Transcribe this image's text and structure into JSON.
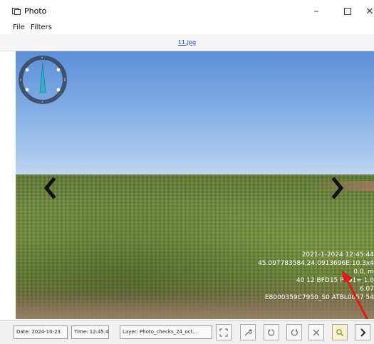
{
  "window": {
    "title": "Photo",
    "minimize": "–",
    "close": "✕"
  },
  "menu": {
    "file": "File",
    "filters": "Filters"
  },
  "top_link": "11.jpg",
  "photo": {
    "overlay_lines": [
      "2021-1-2024 12:45:44",
      "45.097783584,24.0913696E:10.3x4",
      "0.0, m",
      "40 12 BFD15 PR91= 1.0",
      "6.07",
      "E8000359C7950_S0 ATBL0057 54"
    ]
  },
  "status": {
    "date": "Date: 2024-10-23",
    "time": "Time: 12:45:44",
    "layer": "Layer: Photo_checks_24_oct..."
  },
  "icons": {
    "app": "photo-window-icon",
    "compass": "compass-icon",
    "prev": "chevron-left-icon",
    "next": "chevron-right-icon",
    "tools": [
      "fullscreen-icon",
      "wrench-icon",
      "rotate-left-icon",
      "rotate-right-icon",
      "close-x-icon",
      "search-icon",
      "chevron-right-icon"
    ]
  },
  "colors": {
    "pointer_arrow": "#e11b1b",
    "link": "#1a3fb5",
    "compass_needle": "#2fb3c9"
  }
}
